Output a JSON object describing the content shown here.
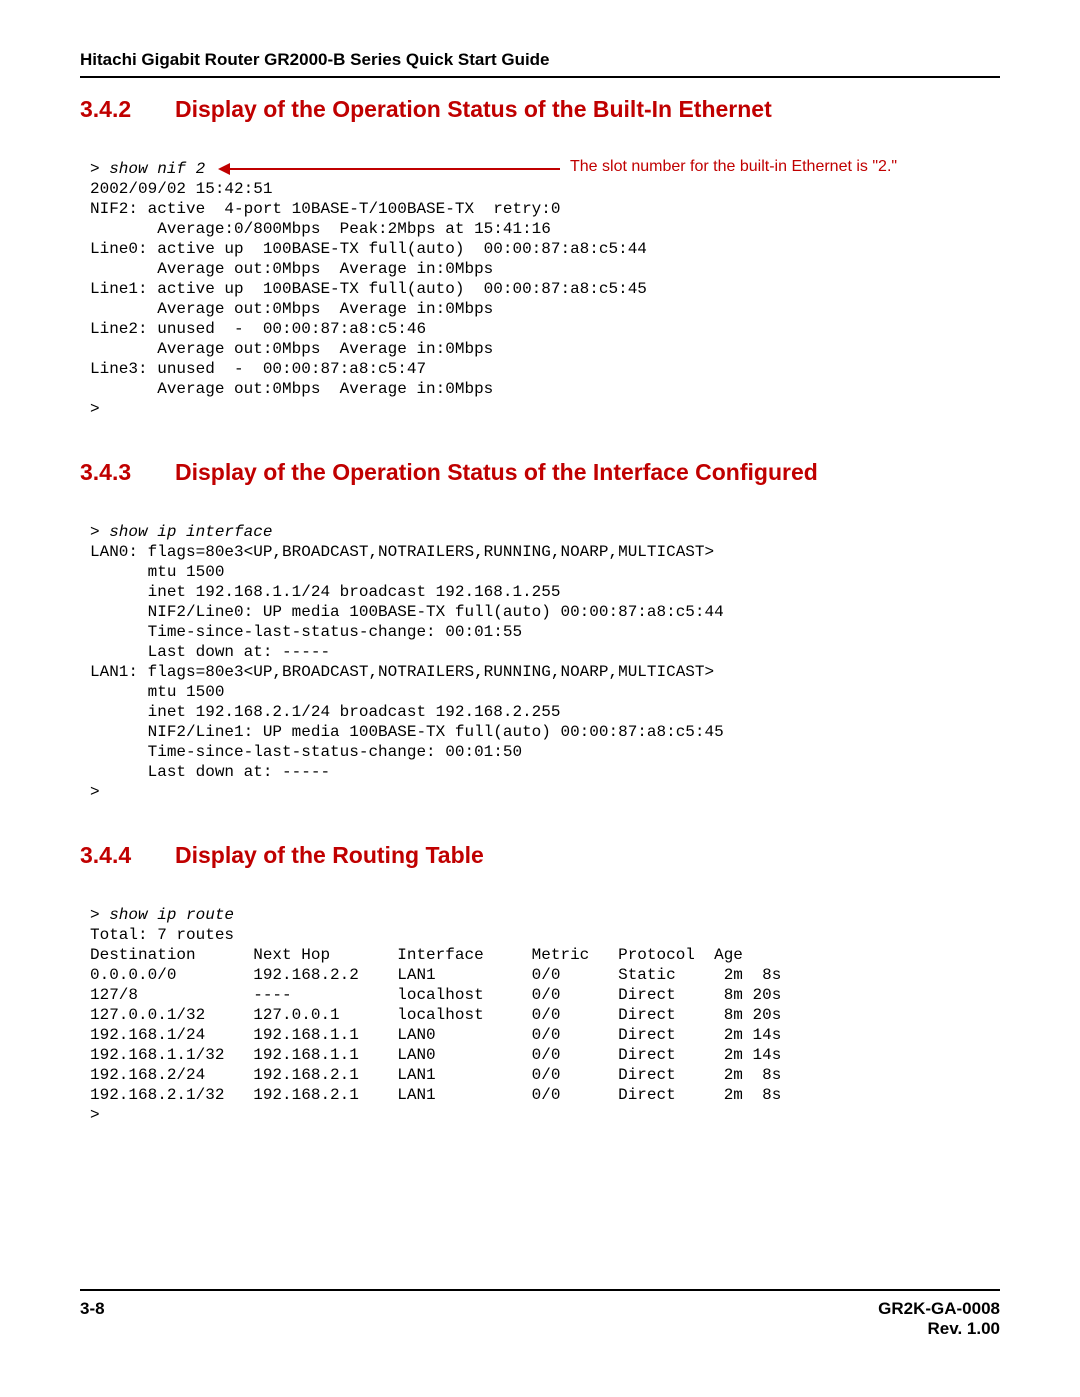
{
  "header": "Hitachi Gigabit Router GR2000-B Series Quick Start Guide",
  "sections": {
    "s342": {
      "num": "3.4.2",
      "title": "Display of the Operation Status of the Built-In Ethernet",
      "cmd_prefix": "> ",
      "cmd": "show nif 2",
      "callout": "The slot number for the built-in Ethernet is \"2.\"",
      "body": "2002/09/02 15:42:51\nNIF2: active  4-port 10BASE-T/100BASE-TX  retry:0\n       Average:0/800Mbps  Peak:2Mbps at 15:41:16\nLine0: active up  100BASE-TX full(auto)  00:00:87:a8:c5:44\n       Average out:0Mbps  Average in:0Mbps\nLine1: active up  100BASE-TX full(auto)  00:00:87:a8:c5:45\n       Average out:0Mbps  Average in:0Mbps\nLine2: unused  -  00:00:87:a8:c5:46\n       Average out:0Mbps  Average in:0Mbps\nLine3: unused  -  00:00:87:a8:c5:47\n       Average out:0Mbps  Average in:0Mbps\n>"
    },
    "s343": {
      "num": "3.4.3",
      "title": "Display of the Operation Status of the Interface Configured",
      "cmd_prefix": "> ",
      "cmd": "show ip interface",
      "body": "LAN0: flags=80e3<UP,BROADCAST,NOTRAILERS,RUNNING,NOARP,MULTICAST>\n      mtu 1500\n      inet 192.168.1.1/24 broadcast 192.168.1.255\n      NIF2/Line0: UP media 100BASE-TX full(auto) 00:00:87:a8:c5:44\n      Time-since-last-status-change: 00:01:55\n      Last down at: -----\nLAN1: flags=80e3<UP,BROADCAST,NOTRAILERS,RUNNING,NOARP,MULTICAST>\n      mtu 1500\n      inet 192.168.2.1/24 broadcast 192.168.2.255\n      NIF2/Line1: UP media 100BASE-TX full(auto) 00:00:87:a8:c5:45\n      Time-since-last-status-change: 00:01:50\n      Last down at: -----\n>"
    },
    "s344": {
      "num": "3.4.4",
      "title": "Display of the Routing Table",
      "cmd_prefix": "> ",
      "cmd": "show ip route",
      "body": "Total: 7 routes\nDestination      Next Hop       Interface     Metric   Protocol  Age\n0.0.0.0/0        192.168.2.2    LAN1          0/0      Static     2m  8s\n127/8            ----           localhost     0/0      Direct     8m 20s\n127.0.0.1/32     127.0.0.1      localhost     0/0      Direct     8m 20s\n192.168.1/24     192.168.1.1    LAN0          0/0      Direct     2m 14s\n192.168.1.1/32   192.168.1.1    LAN0          0/0      Direct     2m 14s\n192.168.2/24     192.168.2.1    LAN1          0/0      Direct     2m  8s\n192.168.2.1/32   192.168.2.1    LAN1          0/0      Direct     2m  8s\n>"
    }
  },
  "footer": {
    "left": "3-8",
    "doc": "GR2K-GA-0008",
    "rev": "Rev. 1.00"
  }
}
